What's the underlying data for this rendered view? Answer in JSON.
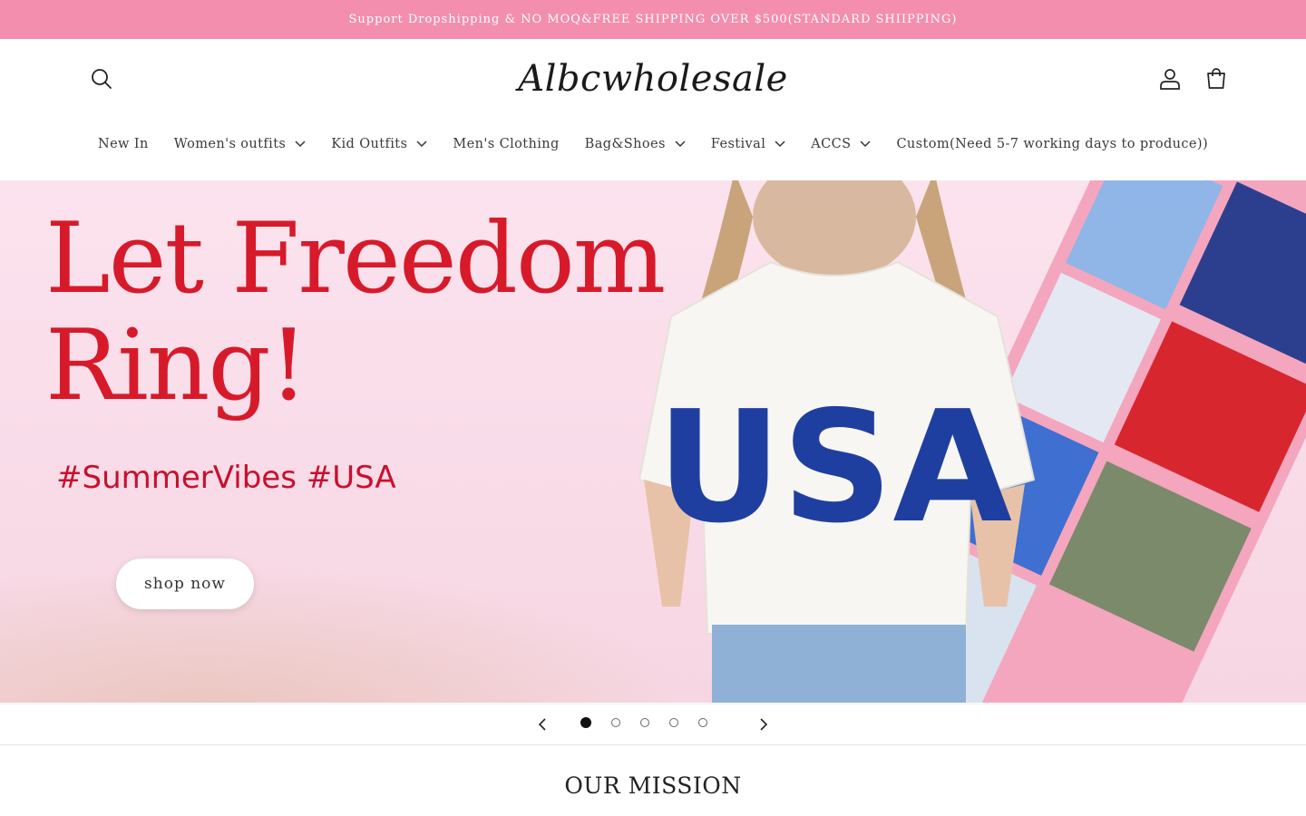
{
  "announcement": {
    "text": "Support Dropshipping & NO MOQ&FREE SHIPPING OVER $500(STANDARD SHIIPPING)"
  },
  "header": {
    "logo": "Albcwholesale",
    "icons": {
      "search": "search-icon",
      "account": "account-icon",
      "cart": "cart-icon"
    }
  },
  "nav": {
    "items": [
      {
        "label": "New In",
        "has_dropdown": false
      },
      {
        "label": "Women's outfits",
        "has_dropdown": true
      },
      {
        "label": "Kid Outfits",
        "has_dropdown": true
      },
      {
        "label": "Men's Clothing",
        "has_dropdown": false
      },
      {
        "label": "Bag&Shoes",
        "has_dropdown": true
      },
      {
        "label": "Festival",
        "has_dropdown": true
      },
      {
        "label": "ACCS",
        "has_dropdown": true
      },
      {
        "label": "Custom(Need 5-7 working days to produce))",
        "has_dropdown": false
      }
    ]
  },
  "hero": {
    "title_line1": "Let Freedom",
    "title_line2": "Ring!",
    "tags": "#SummerVibes #USA",
    "shirt_text": "USA",
    "cta": "shop now"
  },
  "slideshow": {
    "slide_count": 5,
    "active_index": 1
  },
  "mission": {
    "heading": "OUR MISSION"
  },
  "colors": {
    "announcement_bg": "#f38eae",
    "hero_title": "#d71a2a",
    "hero_bg": "#fbe3ee",
    "shirt_letters": "#1f3fa0"
  }
}
